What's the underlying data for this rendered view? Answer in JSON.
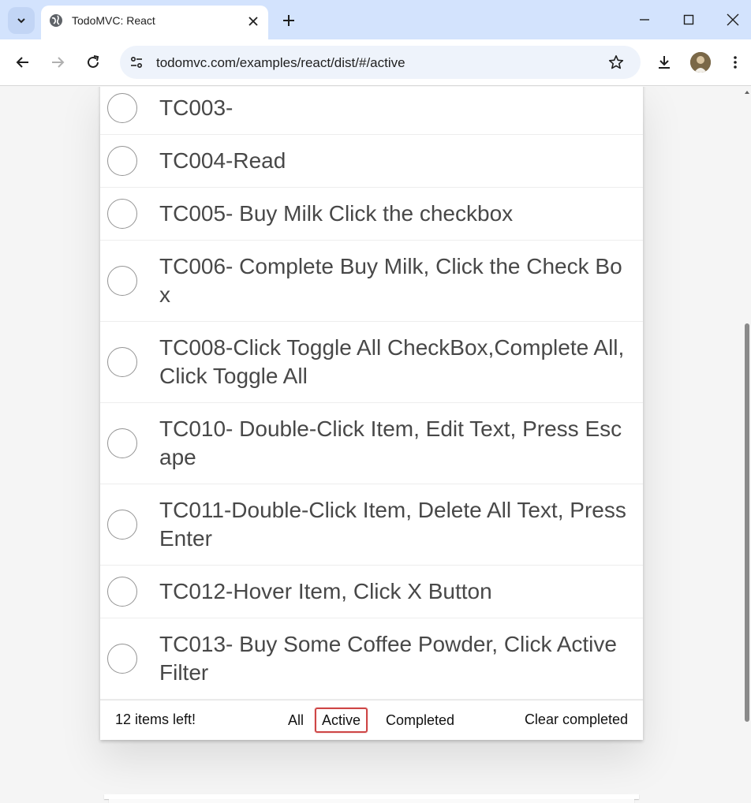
{
  "browser": {
    "tab_title": "TodoMVC: React",
    "url": "todomvc.com/examples/react/dist/#/active",
    "icons": {
      "tab_search": "chevron-down-icon",
      "favicon": "globe-icon",
      "tab_close": "close-icon",
      "new_tab": "plus-icon",
      "minimize": "minimize-icon",
      "maximize": "maximize-icon",
      "close_window": "close-icon",
      "back": "arrow-left-icon",
      "forward": "arrow-right-icon",
      "reload": "reload-icon",
      "site_info": "tune-icon",
      "bookmark": "star-icon",
      "download": "download-icon",
      "menu": "kebab-menu-icon"
    }
  },
  "todos": [
    {
      "label": "TC003-",
      "completed": false
    },
    {
      "label": "TC004-Read",
      "completed": false
    },
    {
      "label": "TC005- Buy Milk Click the checkbox",
      "completed": false
    },
    {
      "label": "TC006- Complete Buy Milk, Click the Check Box",
      "completed": false
    },
    {
      "label": "TC008-Click Toggle All CheckBox,Complete All, Click Toggle All",
      "completed": false
    },
    {
      "label": "TC010- Double-Click Item, Edit Text, Press Escape",
      "completed": false
    },
    {
      "label": "TC011-Double-Click Item, Delete All Text, Press Enter",
      "completed": false
    },
    {
      "label": "TC012-Hover Item, Click X Button",
      "completed": false
    },
    {
      "label": "TC013- Buy Some Coffee Powder, Click Active Filter",
      "completed": false
    }
  ],
  "footer": {
    "count_text": "12 items left!",
    "filters": [
      {
        "label": "All",
        "selected": false
      },
      {
        "label": "Active",
        "selected": true
      },
      {
        "label": "Completed",
        "selected": false
      }
    ],
    "clear_label": "Clear completed"
  },
  "colors": {
    "tabstrip": "#d3e3fd",
    "selected_filter_border": "#ce4646",
    "todo_text": "#484848"
  }
}
